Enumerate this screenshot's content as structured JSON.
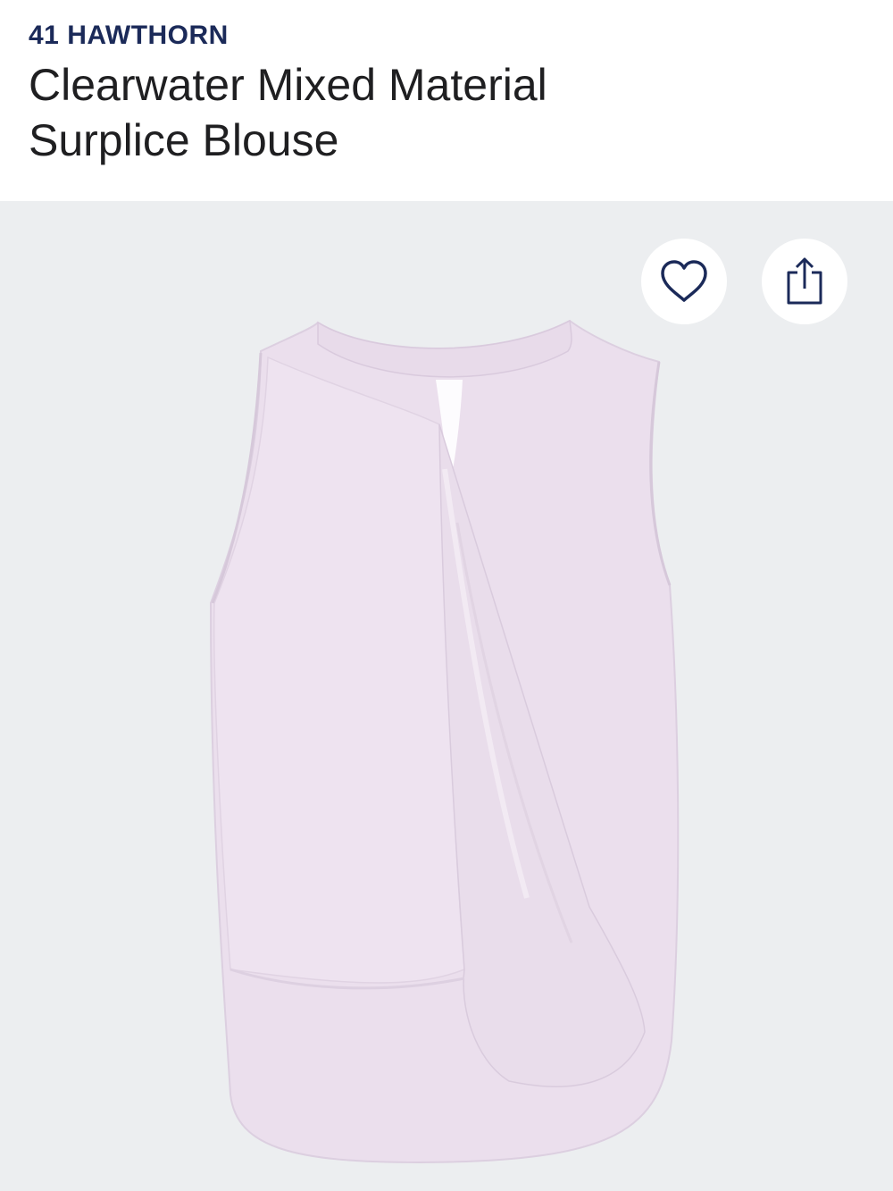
{
  "product": {
    "brand": "41 HAWTHORN",
    "title": "Clearwater Mixed Material Surplice Blouse",
    "image": {
      "alt": "lavender sleeveless surplice blouse",
      "background_color": "#eceef0",
      "garment_color": "#ecdfee"
    }
  },
  "actions": {
    "favorite_icon": "heart-icon",
    "share_icon": "share-icon"
  },
  "colors": {
    "brand_text": "#1b2a59",
    "title_text": "#1f1f21",
    "icon_stroke": "#1b2a59"
  }
}
